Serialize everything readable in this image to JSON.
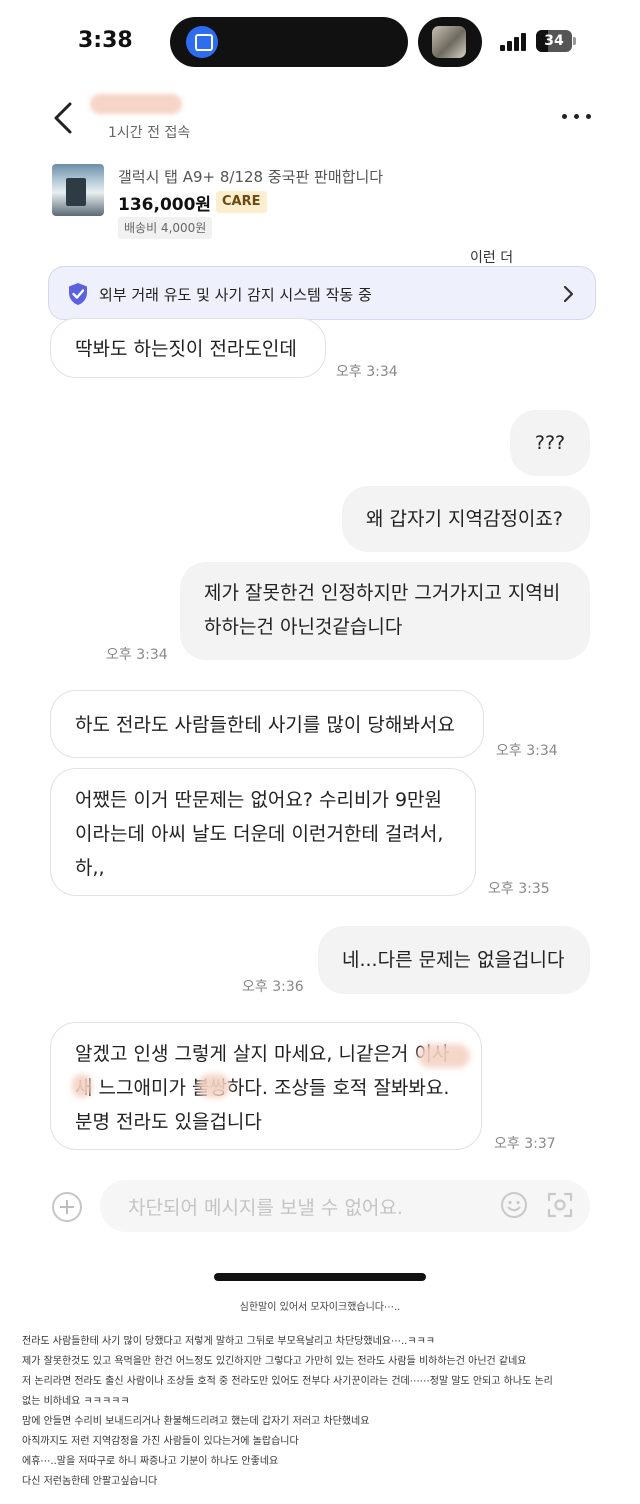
{
  "status_bar": {
    "time": "3:38",
    "battery": "34",
    "battery_level": 0.34
  },
  "header": {
    "last_seen": "1시간 전 접속"
  },
  "product": {
    "title": "갤럭시 탭 A9+ 8/128 중국판 판매합니다",
    "price": "136,000원",
    "care_badge": "CARE",
    "shipping": "배송비 4,000원"
  },
  "banner": {
    "peek_text": "이런 더",
    "text": "외부 거래 유도 및 사기 감지 시스템 작동 중"
  },
  "messages": [
    {
      "side": "in",
      "text": "딱봐도 하는짓이 전라도인데",
      "time": "오후 3:34"
    },
    {
      "side": "out",
      "text": "???"
    },
    {
      "side": "out",
      "text": "왜 갑자기 지역감정이죠?"
    },
    {
      "side": "out",
      "lines": [
        "제가 잘못한건 인정하지만 그거가지고 지역비",
        "하하는건 아닌것같습니다"
      ],
      "time": "오후 3:34"
    },
    {
      "side": "in",
      "text": "하도 전라도 사람들한테 사기를 많이 당해봐서요",
      "time": "오후 3:34"
    },
    {
      "side": "in",
      "lines": [
        "어쨌든 이거 딴문제는 없어요? 수리비가 9만원",
        "이라는데 아씨 날도 더운데 이런거한테 걸려서,",
        "하,,"
      ],
      "time": "오후 3:35"
    },
    {
      "side": "out",
      "text": "네...다른 문제는 없을겁니다",
      "time": "오후 3:36"
    },
    {
      "side": "in",
      "lines": [
        "알겠고 인생 그렇게 살지 마세요, 니같은거 이사",
        "새 느그애미가 불쌍하다. 조상들 호적 잘봐봐요.",
        "분명 전라도 있을겁니다"
      ],
      "time": "오후 3:37"
    }
  ],
  "input": {
    "placeholder": "차단되어 메시지를 보낼 수 없어요."
  },
  "caption": {
    "note": "심한말이 있어서 모자이크했습니다⋯..",
    "lines": [
      "전라도 사람들한테 사기 많이 당했다고 저렇게 말하고 그뒤로 부모욕날리고 차단당했네요⋯..ㅋㅋㅋ",
      "제가 잘못한것도 있고 욕먹을만 한건 어느정도 있긴하지만 그렇다고 가만히 있는 전라도 사람들 비하하는건 아닌건 같네요",
      "저 논리라면 전라도 출신 사람이나 조상들 호적 중 전라도만 있어도 전부다 사기꾼이라는 건데⋯⋯정말 말도 안되고 하나도 논리",
      "없는 비하네요 ㅋㅋㅋㅋㅋ",
      "맘에 안들면 수리비 보내드리거나 환불해드리려고 했는데 갑자기 저러고 차단했네요",
      "아직까지도 저런 지역감정을 가진 사람들이 있다는거에 놀랍습니다",
      "에휴⋯..말을 저따구로 하니 짜증나고 기분이 하나도 안좋네요",
      "다신 저런놈한테 안팔고싶습니다"
    ]
  },
  "colors": {
    "incoming_bubble": "#ffffff",
    "outgoing_bubble": "#f3f3f4",
    "banner_bg": "#eef0fb",
    "shield": "#5b62e0",
    "care_bg": "#fdeed0"
  },
  "icons": [
    "back-arrow-icon",
    "more-dots-icon",
    "shield-check-icon",
    "chevron-right-icon",
    "plus-icon",
    "emoji-icon",
    "scan-icon",
    "bus-icon",
    "signal-icon",
    "battery-icon"
  ]
}
